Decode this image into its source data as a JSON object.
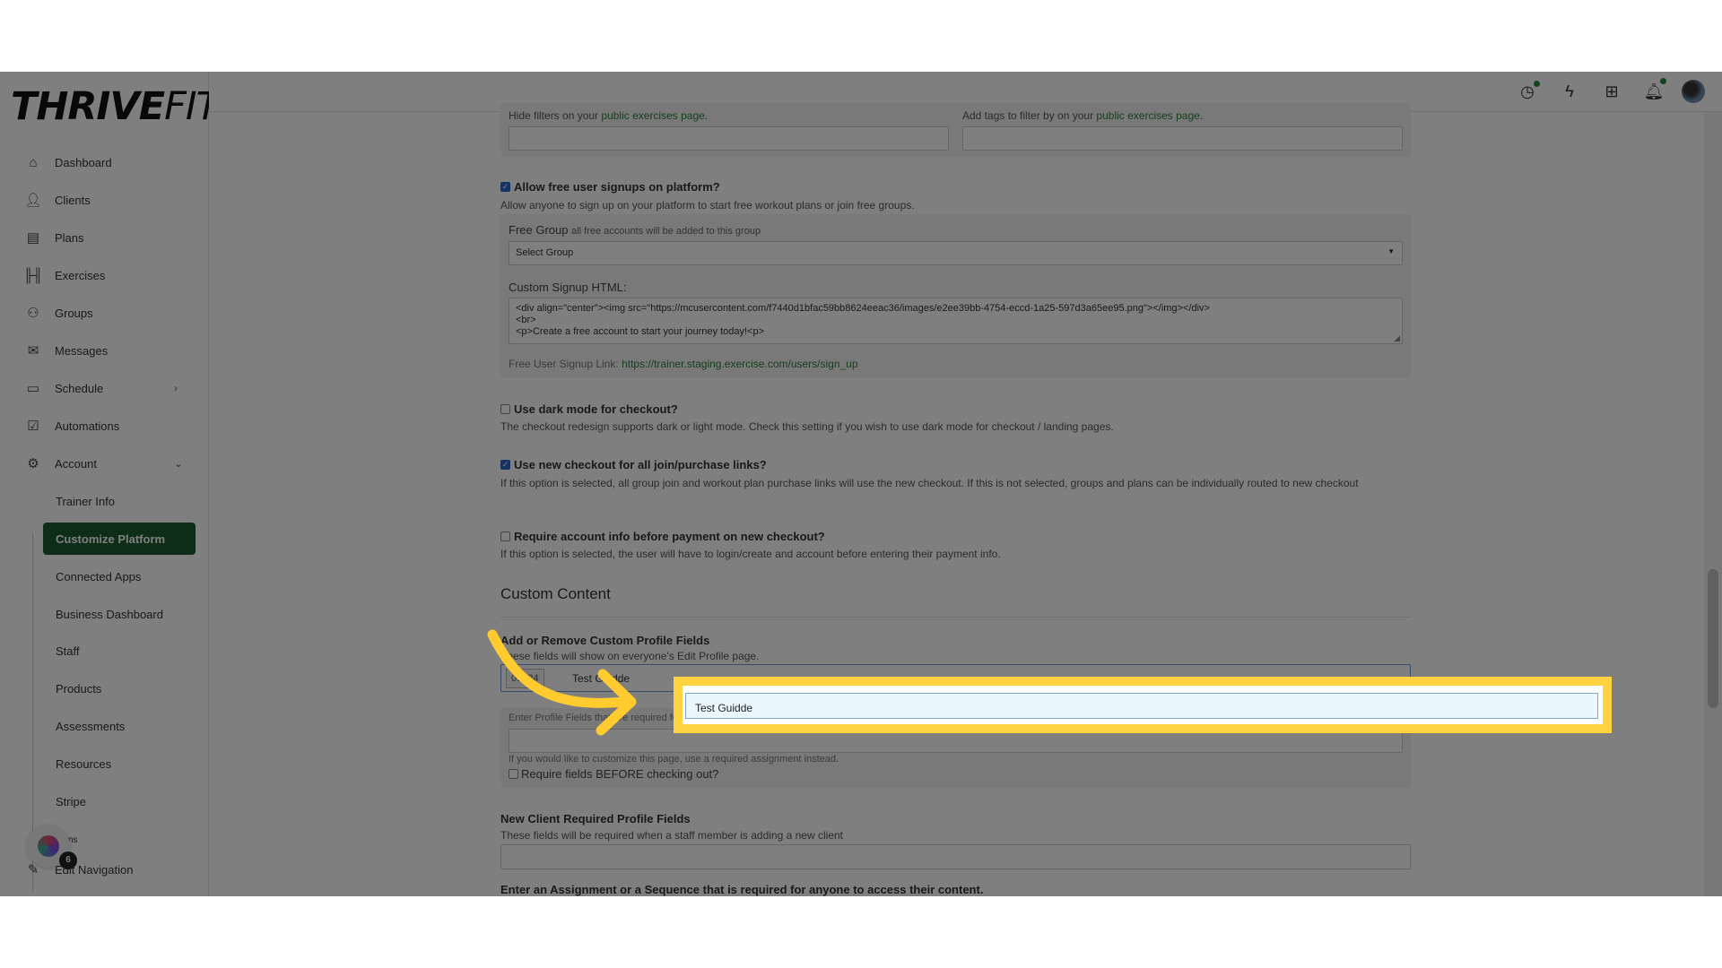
{
  "brand": {
    "logo_bold": "THRIVE",
    "logo_light": "FIT"
  },
  "sidebar": {
    "items": [
      {
        "label": "Dashboard",
        "icon": "home-icon"
      },
      {
        "label": "Clients",
        "icon": "user-icon"
      },
      {
        "label": "Plans",
        "icon": "clipboard-icon"
      },
      {
        "label": "Exercises",
        "icon": "dumbbell-icon"
      },
      {
        "label": "Groups",
        "icon": "group-icon"
      },
      {
        "label": "Messages",
        "icon": "mail-icon"
      },
      {
        "label": "Schedule",
        "icon": "calendar-icon"
      },
      {
        "label": "Automations",
        "icon": "check-square-icon"
      },
      {
        "label": "Account",
        "icon": "gear-icon"
      }
    ],
    "sub_items": [
      "Trainer Info",
      "Customize Platform",
      "Connected Apps",
      "Business Dashboard",
      "Staff",
      "Products",
      "Assessments",
      "Resources",
      "Stripe",
      "ns"
    ],
    "active": "Customize Platform",
    "edit_nav": "Edit Navigation",
    "badge_count": "6"
  },
  "header": {
    "icons": [
      "clock-icon",
      "lightning-icon",
      "apps-grid-icon",
      "bell-icon"
    ]
  },
  "content": {
    "hide_filters": {
      "text": "Hide filters on your ",
      "link": "public exercises page",
      "end": "."
    },
    "add_tags": {
      "text": "Add tags to filter by on your ",
      "link": "public exercises page",
      "end": "."
    },
    "free_signup": {
      "label": "Allow free user signups on platform?",
      "checked": true,
      "desc": "Allow anyone to sign up on your platform to start free workout plans or join free groups.",
      "free_group_label": "Free Group",
      "free_group_hint": "all free accounts will be added to this group",
      "select_value": "Select Group",
      "html_label": "Custom Signup HTML:",
      "html_lines": [
        "<div align=\"center\"><img src=\"https://mcusercontent.com/f7440d1bfac59bb8624eeac36/images/e2ee39bb-4754-eccd-1a25-597d3a65ee95.png\"></img></div>",
        "<br>",
        "<p>Create a free account to start your journey today!<p>"
      ],
      "link_label": "Free User Signup Link: ",
      "link": "https://trainer.staging.exercise.com/users/sign_up"
    },
    "dark_mode": {
      "label": "Use dark mode for checkout?",
      "checked": false,
      "desc": "The checkout redesign supports dark or light mode. Check this setting if you wish to use dark mode for checkout / landing pages."
    },
    "new_checkout": {
      "label": "Use new checkout for all join/purchase links?",
      "checked": true,
      "desc": "If this option is selected, all group join and workout plan purchase links will use the new checkout. If this is not selected, groups and plans can be individually routed to new checkout"
    },
    "require_account": {
      "label": "Require account info before payment on new checkout?",
      "checked": false,
      "desc": "If this option is selected, the user will have to login/create and account before entering their payment info."
    },
    "custom_content_title": "Custom Content",
    "profile_fields": {
      "label": "Add or Remove Custom Profile Fields",
      "desc": "These fields will show on everyone's Edit Profile page.",
      "tag": "01924",
      "input_value": "Test Guidde",
      "enter_label": "Enter Profile Fields that are required for anyone to access their content (order is preserved)",
      "help": "If you would like to customize this page, use a required assignment instead.",
      "require_before": "Require fields BEFORE checking out?",
      "require_before_checked": false
    },
    "new_client": {
      "label": "New Client Required Profile Fields",
      "desc": "These fields will be required when a staff member is adding a new client"
    },
    "assignment_label": "Enter an Assignment or a Sequence that is required for anyone to access their content."
  },
  "dropdown": {
    "option": "Test Guidde"
  },
  "colors": {
    "accent": "#1d5a2e",
    "highlight": "#ffd23f",
    "link": "#2f7d3a"
  }
}
